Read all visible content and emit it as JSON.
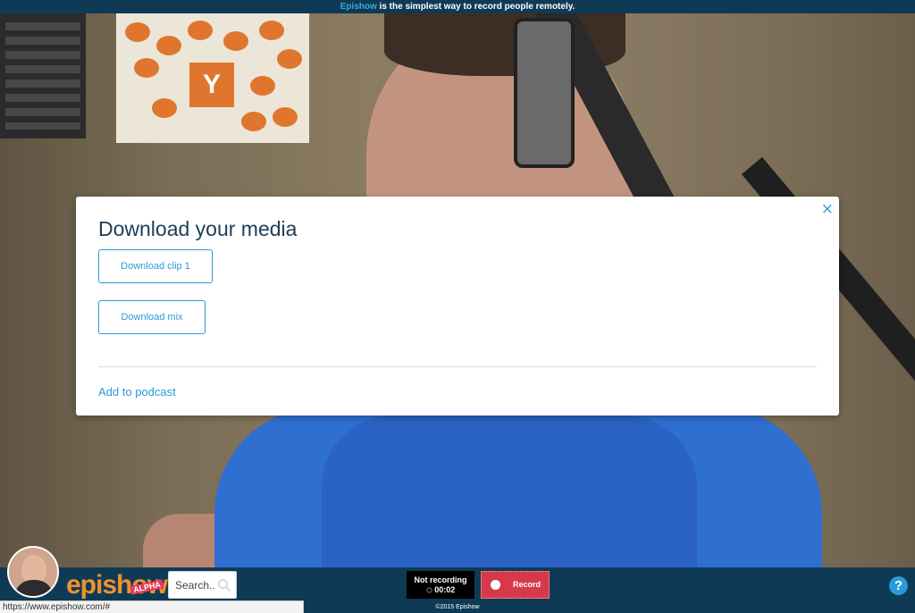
{
  "banner": {
    "brand": "Epishow",
    "text": " is the simplest way to record people remotely."
  },
  "video": {
    "poster_letter": "Y"
  },
  "modal": {
    "title": "Download your media",
    "close_glyph": "×",
    "buttons": [
      "Download clip 1",
      "Download mix"
    ],
    "link": "Add to podcast"
  },
  "bottom_bar": {
    "logo": "epishow",
    "badge": "ALPHA",
    "search_placeholder": "Search..",
    "recording_status": "Not recording",
    "timer": "00:02",
    "record_label": "Record",
    "copyright": "©2015 Epishow",
    "help_glyph": "?"
  },
  "status_url": "https://www.epishow.com/#",
  "icons": {
    "search": "search-icon",
    "close": "close-icon",
    "help": "help-icon",
    "record": "record-dot-icon",
    "timer": "timer-icon"
  },
  "colors": {
    "bar": "#0f3a55",
    "accent": "#2a9ad8",
    "record": "#d63a4a",
    "logo": "#f0922e"
  }
}
